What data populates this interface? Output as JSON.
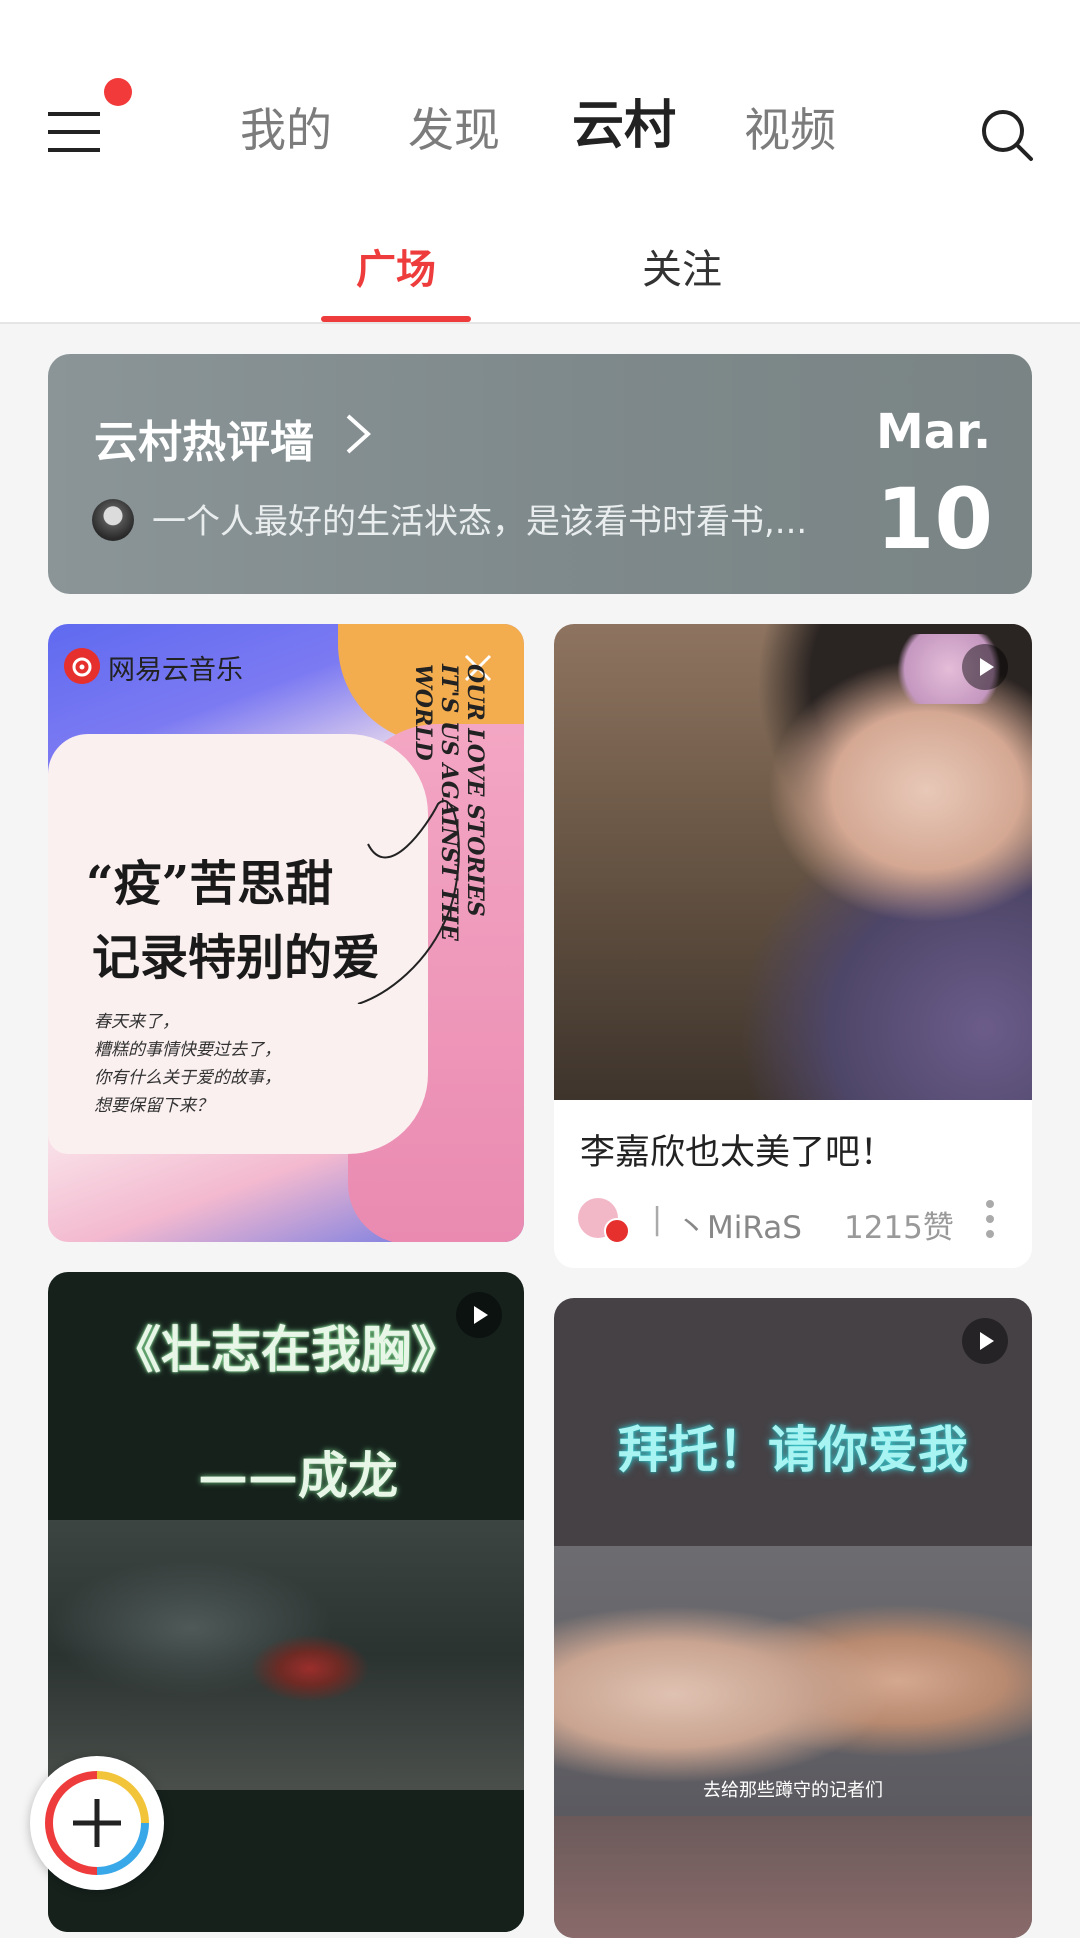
{
  "header": {
    "menu_icon": "hamburger-menu-icon",
    "tabs": [
      {
        "label": "我的",
        "active": false
      },
      {
        "label": "发现",
        "active": false
      },
      {
        "label": "云村",
        "active": true
      },
      {
        "label": "视频",
        "active": false
      }
    ],
    "search_icon": "search-icon"
  },
  "subtabs": [
    {
      "label": "广场",
      "active": true
    },
    {
      "label": "关注",
      "active": false
    }
  ],
  "hot_comments": {
    "title": "云村热评墙",
    "snippet": "一个人最好的生活状态，是该看书时看书,...",
    "month": "Mar.",
    "day": "10"
  },
  "feed": {
    "card_a": {
      "brand": "网易云音乐",
      "vertical_text": "OUR LOVE STORIES IT'S US AGAINST THE WORLD",
      "headline1": "“疫”苦思甜",
      "headline2": "记录特别的爱",
      "body": [
        "春天来了，",
        "糟糕的事情快要过去了，",
        "你有什么关于爱的故事，",
        "想要保留下来？"
      ]
    },
    "card_b": {
      "title": "李嘉欣也太美了吧！",
      "separator": "|",
      "user": "丶MiRaS",
      "likes": "1215赞"
    },
    "card_c": {
      "title": "《壮志在我胸》",
      "subtitle": "——成龙"
    },
    "card_d": {
      "title": "拜托！请你爱我",
      "caption": "去给那些蹲守的记者们"
    }
  },
  "colors": {
    "accent": "#ee3c3c",
    "badge": "#f23a3a"
  }
}
